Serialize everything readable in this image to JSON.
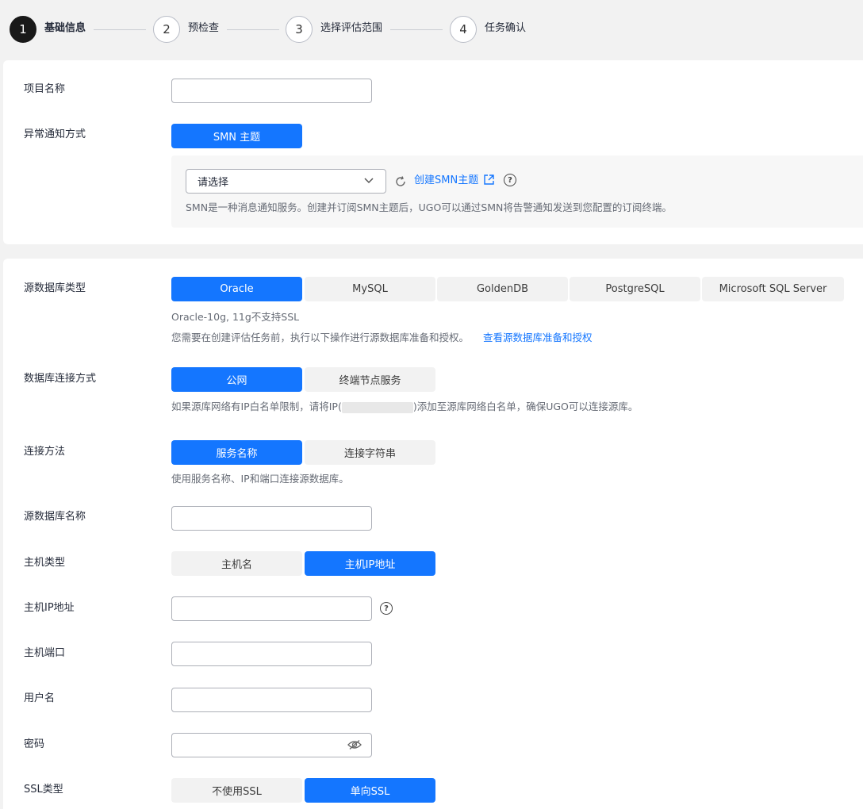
{
  "stepper": {
    "steps": [
      {
        "num": "1",
        "label": "基础信息"
      },
      {
        "num": "2",
        "label": "预检查"
      },
      {
        "num": "3",
        "label": "选择评估范围"
      },
      {
        "num": "4",
        "label": "任务确认"
      }
    ]
  },
  "project": {
    "name_label": "项目名称",
    "name_value": "",
    "notify_label": "异常通知方式",
    "notify_option": "SMN 主题",
    "select_placeholder": "请选择",
    "create_link": "创建SMN主题",
    "smn_hint": "SMN是一种消息通知服务。创建并订阅SMN主题后，UGO可以通过SMN将告警通知发送到您配置的订阅终端。"
  },
  "source": {
    "db_type_label": "源数据库类型",
    "db_types": [
      "Oracle",
      "MySQL",
      "GoldenDB",
      "PostgreSQL",
      "Microsoft SQL Server"
    ],
    "db_type_selected": "Oracle",
    "oracle_hint": "Oracle-10g, 11g不支持SSL",
    "prep_hint": "您需要在创建评估任务前，执行以下操作进行源数据库准备和授权。",
    "prep_link": "查看源数据库准备和授权",
    "conn_mode_label": "数据库连接方式",
    "conn_modes": [
      "公网",
      "终端节点服务"
    ],
    "conn_mode_hint_pre": "如果源库网络有IP白名单限制，请将IP(",
    "conn_mode_hint_post": ")添加至源库网络白名单，确保UGO可以连接源库。",
    "conn_method_label": "连接方法",
    "conn_methods": [
      "服务名称",
      "连接字符串"
    ],
    "conn_method_hint": "使用服务名称、IP和端口连接源数据库。",
    "db_name_label": "源数据库名称",
    "host_type_label": "主机类型",
    "host_types": [
      "主机名",
      "主机IP地址"
    ],
    "host_ip_label": "主机IP地址",
    "host_port_label": "主机端口",
    "username_label": "用户名",
    "password_label": "密码",
    "ssl_label": "SSL类型",
    "ssl_types": [
      "不使用SSL",
      "单向SSL"
    ]
  },
  "colors": {
    "accent": "#1476ff",
    "step_active": "#191919"
  }
}
